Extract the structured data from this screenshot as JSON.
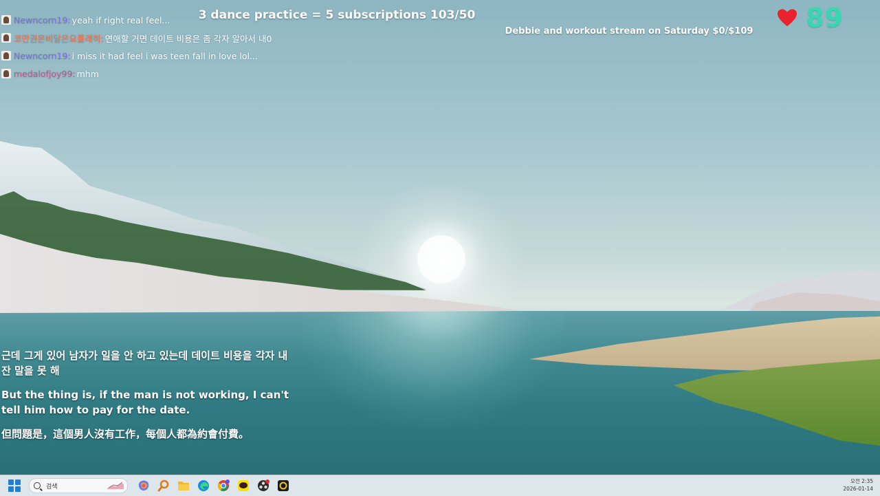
{
  "chat": [
    {
      "user": "Newncorn19:",
      "message": "yeah if right real feel...",
      "user_color": "#7b6fe0"
    },
    {
      "user": "코만권은비달은요를래히:",
      "message": "연애할 거면 데이트 비용은 좀 각자 알아서 내0",
      "user_color": "#ff6a3d"
    },
    {
      "user": "Newncorn19:",
      "message": "i miss it had feel i was teen fall in love lol...",
      "user_color": "#7b6fe0"
    },
    {
      "user": "medalofjoy99:",
      "message": "mhm",
      "user_color": "#c2558c"
    }
  ],
  "goals": {
    "main": "3 dance practice = 5 subscriptions 103/50",
    "sub": "Debbie and workout stream on Saturday $0/$109"
  },
  "likes": {
    "count": "89",
    "heart_color": "#e8232d",
    "count_color": "#39d6b4"
  },
  "subtitles": [
    "근데 그게 있어 남자가 일을 안 하고 있는데 데이트 비용을 각자 내 잔 말을 못 해",
    "But the thing is, if the man is not working, I can't tell him how to pay for the date.",
    "但問題是，這個男人沒有工作，每個人都為約會付費。"
  ],
  "taskbar": {
    "search_placeholder": "검색",
    "icons": [
      "copilot-icon",
      "magnifier-app-icon",
      "file-explorer-icon",
      "edge-icon",
      "chrome-icon",
      "kakaotalk-icon",
      "obs-icon",
      "camera-app-icon"
    ],
    "time": "오전 2:35",
    "date": "2026-01-14"
  }
}
